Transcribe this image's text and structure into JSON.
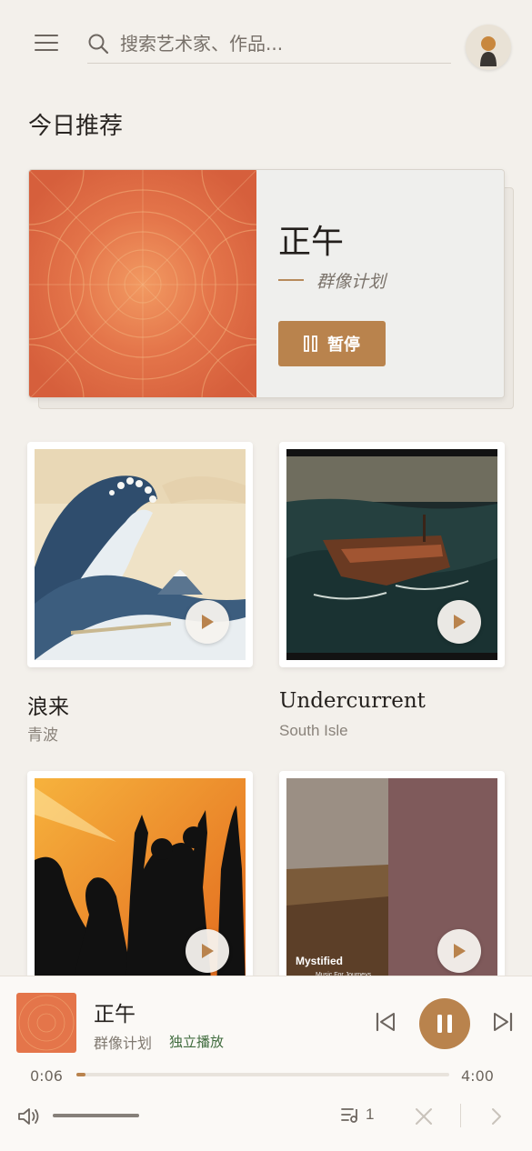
{
  "header": {
    "search_placeholder": "搜索艺术家、作品..."
  },
  "section_title": "今日推荐",
  "featured": {
    "title": "正午",
    "artist": "群像计划",
    "pause_label": "暂停"
  },
  "cards": [
    {
      "title": "浪来",
      "artist": "青波"
    },
    {
      "title": "Undercurrent",
      "artist": "South Isle"
    },
    {
      "title": "",
      "artist": ""
    },
    {
      "title": "",
      "artist": "",
      "cover_text_1": "Mystified",
      "cover_text_2": "Music For Journeys"
    }
  ],
  "player": {
    "title": "正午",
    "artist": "群像计划",
    "badge": "独立播放",
    "time_current": "0:06",
    "time_total": "4:00",
    "progress": 0.025,
    "volume": 1.0,
    "queue_count": "1"
  },
  "colors": {
    "accent": "#b9834d",
    "background": "#f3f0eb",
    "badge_green": "#3f6b3d"
  },
  "icons": [
    "menu-icon",
    "search-icon",
    "avatar-icon",
    "pause-icon",
    "play-icon",
    "skip-previous-icon",
    "skip-next-icon",
    "volume-icon",
    "queue-icon",
    "close-icon",
    "chevron-right-icon"
  ]
}
